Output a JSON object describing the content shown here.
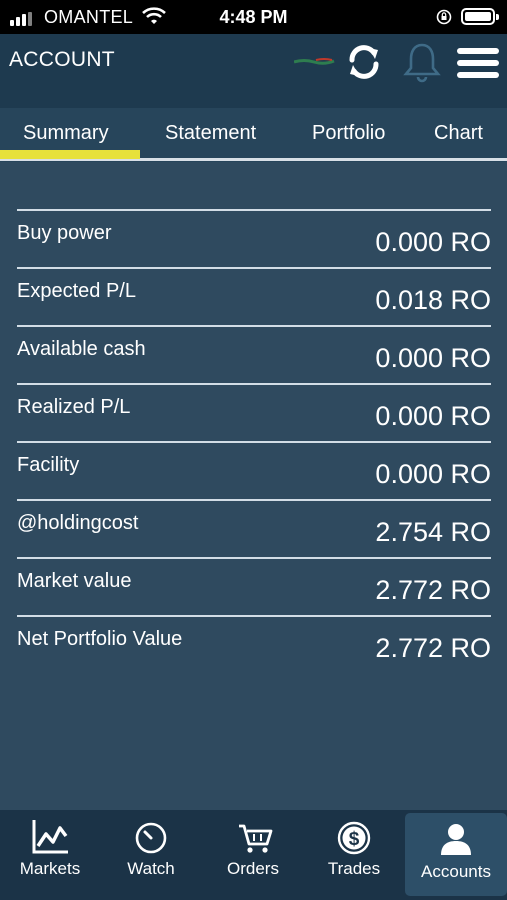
{
  "status_bar": {
    "carrier": "OMANTEL",
    "time": "4:48 PM"
  },
  "header": {
    "title": "ACCOUNT"
  },
  "tabs": [
    {
      "label": "Summary"
    },
    {
      "label": "Statement"
    },
    {
      "label": "Portfolio"
    },
    {
      "label": "Chart"
    }
  ],
  "summary_rows": [
    {
      "label": "Buy power",
      "value": "0.000 RO"
    },
    {
      "label": "Expected P/L",
      "value": "0.018 RO"
    },
    {
      "label": "Available cash",
      "value": "0.000 RO"
    },
    {
      "label": "Realized P/L",
      "value": "0.000 RO"
    },
    {
      "label": "Facility",
      "value": "0.000 RO"
    },
    {
      "label": "@holdingcost",
      "value": "2.754 RO"
    },
    {
      "label": "Market value",
      "value": "2.772 RO"
    },
    {
      "label": "Net Portfolio Value",
      "value": "2.772 RO"
    }
  ],
  "tab_bar": [
    {
      "label": "Markets",
      "icon": "chart-line-icon"
    },
    {
      "label": "Watch",
      "icon": "clock-icon"
    },
    {
      "label": "Orders",
      "icon": "cart-icon"
    },
    {
      "label": "Trades",
      "icon": "dollar-coin-icon"
    },
    {
      "label": "Accounts",
      "icon": "user-icon"
    }
  ],
  "colors": {
    "accent": "#e7e13a",
    "header_bg": "#1e3a4f",
    "body_bg": "#2f4a5f"
  }
}
